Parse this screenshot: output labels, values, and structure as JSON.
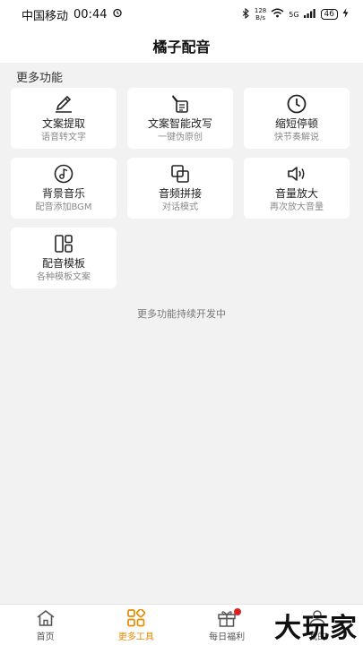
{
  "status": {
    "carrier": "中国移动",
    "time": "00:44",
    "speed_top": "128",
    "speed_bottom": "B/s",
    "net": "5G",
    "battery": "46"
  },
  "header": {
    "title": "橘子配音"
  },
  "section": {
    "title": "更多功能"
  },
  "tools": [
    {
      "title": "文案提取",
      "subtitle": "语音转文字",
      "icon": "pen-icon"
    },
    {
      "title": "文案智能改写",
      "subtitle": "一键伪原创",
      "icon": "rewrite-icon"
    },
    {
      "title": "缩短停顿",
      "subtitle": "快节奏解说",
      "icon": "clock-icon"
    },
    {
      "title": "背景音乐",
      "subtitle": "配音添加BGM",
      "icon": "music-disc-icon"
    },
    {
      "title": "音频拼接",
      "subtitle": "对话模式",
      "icon": "splice-icon"
    },
    {
      "title": "音量放大",
      "subtitle": "再次放大音量",
      "icon": "speaker-icon"
    },
    {
      "title": "配音模板",
      "subtitle": "各种模板文案",
      "icon": "template-icon"
    }
  ],
  "footer_note": "更多功能持续开发中",
  "tabs": [
    {
      "label": "首页",
      "icon": "home-icon"
    },
    {
      "label": "更多工具",
      "icon": "tools-grid-icon",
      "active": true
    },
    {
      "label": "每日福利",
      "icon": "gift-icon"
    },
    {
      "label": "我的",
      "icon": "user-icon"
    }
  ],
  "watermark": "大玩家",
  "colors": {
    "accent": "#e68a00",
    "badge": "#e02020",
    "background": "#f2f2f2"
  }
}
